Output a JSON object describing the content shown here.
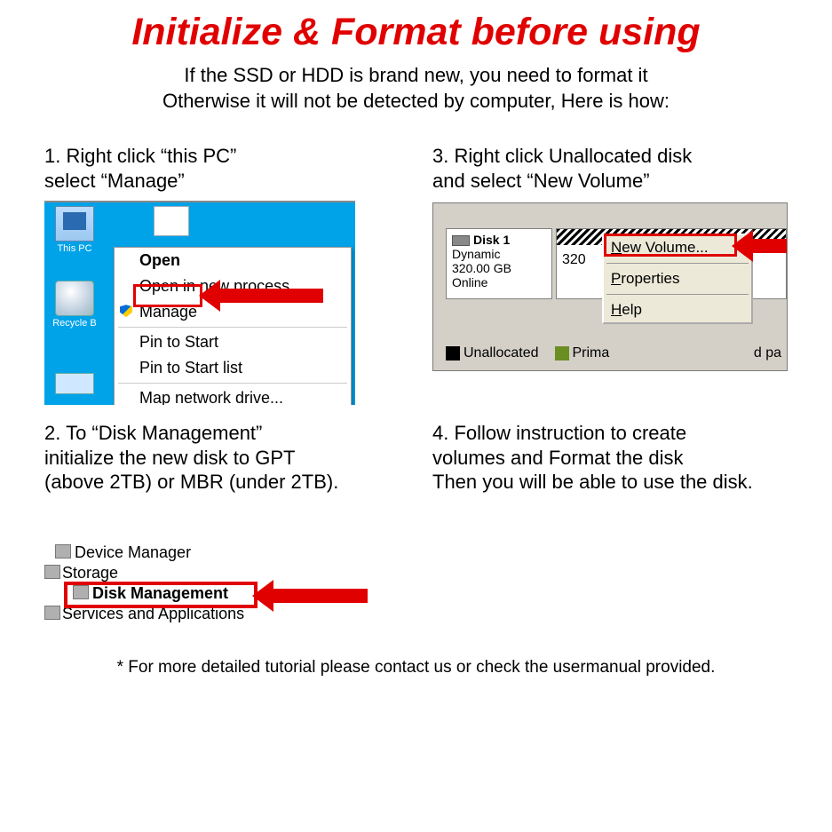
{
  "title": "Initialize & Format before using",
  "subtitle_l1": "If the SSD or HDD is brand new, you need to format it",
  "subtitle_l2": "Otherwise it will not be detected by computer, Here is how:",
  "step1_l1": "1. Right click “this PC”",
  "step1_l2": "select “Manage”",
  "step2_l1": "2. To “Disk Management”",
  "step2_l2": "initialize the new disk to GPT",
  "step2_l3": "(above 2TB) or MBR (under 2TB).",
  "step3_l1": "3. Right click Unallocated disk",
  "step3_l2": "and select “New Volume”",
  "step4_l1": "4. Follow instruction to create",
  "step4_l2": "volumes and Format the disk",
  "step4_l3": "Then you will be able to use the disk.",
  "footer": "* For more detailed tutorial please contact us or check the usermanual provided.",
  "shot1": {
    "icon_thispc": "This PC",
    "icon_recycle": "Recycle B",
    "menu": {
      "open": "Open",
      "open_new": "Open in new process",
      "manage": "Manage",
      "pin_start": "Pin to Start",
      "pin_startlist": "Pin to Start list",
      "map_drive": "Map network drive..."
    }
  },
  "shot3": {
    "disk_label": "Disk 1",
    "disk_type": "Dynamic",
    "disk_size": "320.00 GB",
    "disk_status": "Online",
    "vol_size": "320",
    "legend_unalloc": "Unallocated",
    "legend_primary_prefix": "Prima",
    "legend_right": "d pa",
    "menu": {
      "new_volume": "New Volume...",
      "properties": "Properties",
      "help": "Help"
    }
  },
  "shot2": {
    "device_mgr": "Device Manager",
    "storage": "Storage",
    "disk_mgmt": "Disk Management",
    "services": "Services and Applications"
  }
}
